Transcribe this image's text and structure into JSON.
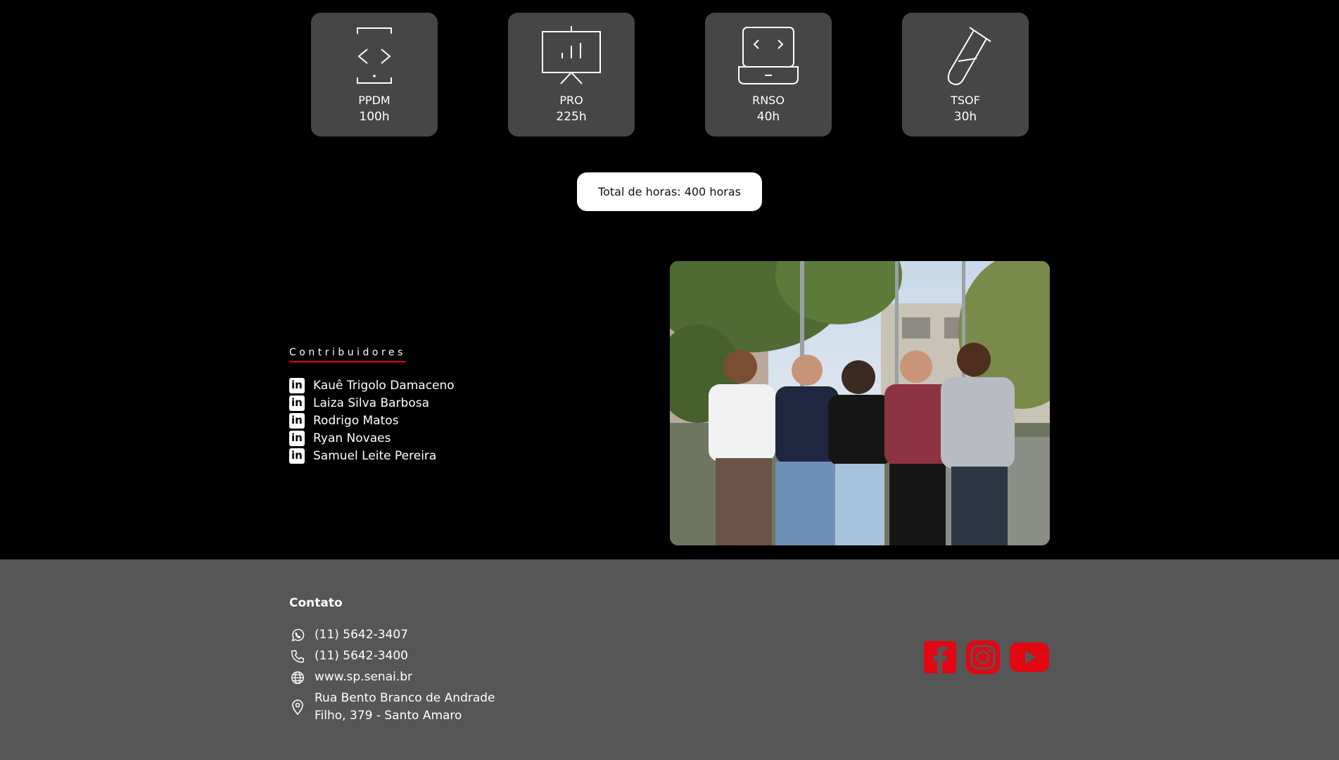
{
  "courses": [
    {
      "name": "PPDM",
      "hours": "100h",
      "icon": "mobile-code-icon"
    },
    {
      "name": "PRO",
      "hours": "225h",
      "icon": "presentation-chart-icon"
    },
    {
      "name": "RNSO",
      "hours": "40h",
      "icon": "laptop-code-icon"
    },
    {
      "name": "TSOF",
      "hours": "30h",
      "icon": "test-tube-icon"
    }
  ],
  "total": {
    "label": "Total de horas: 400 horas"
  },
  "contributors": {
    "title": "Contribuidores",
    "names": [
      "Kauê Trigolo Damaceno",
      "Laiza Silva Barbosa",
      "Rodrigo Matos",
      "Ryan Novaes",
      "Samuel Leite Pereira"
    ]
  },
  "footer": {
    "contact_title": "Contato",
    "whatsapp": "(11) 5642-3407",
    "phone": "(11) 5642-3400",
    "website": "www.sp.senai.br",
    "address_line1": "Rua Bento Branco de Andrade",
    "address_line2": "Filho, 379 - Santo Amaro"
  },
  "colors": {
    "accent": "#e30613",
    "card": "#464646",
    "footer": "#565656"
  }
}
